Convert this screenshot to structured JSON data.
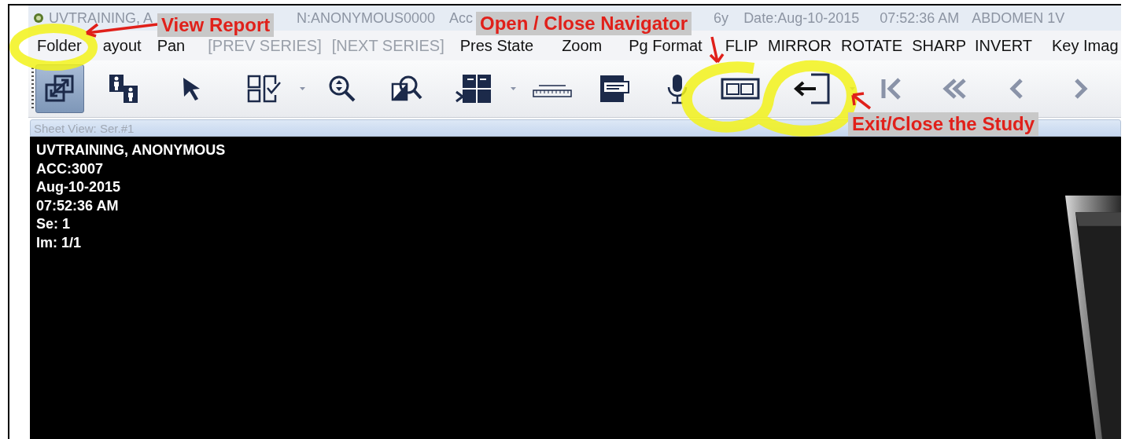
{
  "window": {
    "title_segments": [
      "UVTRAINING, A",
      "N:ANONYMOUS0000",
      "Acc",
      "6y",
      "Date:Aug-10-2015",
      "07:52:36 AM",
      "ABDOMEN 1V"
    ]
  },
  "menu": [
    {
      "label": "Folder",
      "disabled": false
    },
    {
      "label": "ayout",
      "disabled": false
    },
    {
      "label": "Pan",
      "disabled": false
    },
    {
      "label": "[PREV SERIES]",
      "disabled": true
    },
    {
      "label": "[NEXT SERIES]",
      "disabled": true
    },
    {
      "label": "Pres State",
      "disabled": false
    },
    {
      "label": "Zoom",
      "disabled": false
    },
    {
      "label": "Pg Format",
      "disabled": false
    },
    {
      "label": "FLIP",
      "disabled": false
    },
    {
      "label": "MIRROR",
      "disabled": false
    },
    {
      "label": "ROTATE",
      "disabled": false
    },
    {
      "label": "SHARP",
      "disabled": false
    },
    {
      "label": "INVERT",
      "disabled": false
    },
    {
      "label": "Key Imag",
      "disabled": false
    }
  ],
  "toolbar": [
    {
      "kind": "expand",
      "selected": true
    },
    {
      "kind": "figures",
      "selected": false
    },
    {
      "kind": "pointer",
      "selected": false
    },
    {
      "kind": "layout",
      "selected": false,
      "caret": true
    },
    {
      "kind": "zoom",
      "selected": false
    },
    {
      "kind": "magnify-area",
      "selected": false
    },
    {
      "kind": "split",
      "selected": false,
      "caret": true
    },
    {
      "kind": "ruler",
      "selected": false
    },
    {
      "kind": "report",
      "selected": false
    },
    {
      "kind": "mic",
      "selected": false
    },
    {
      "kind": "navigator",
      "selected": false
    },
    {
      "kind": "exit",
      "selected": false,
      "caret": true
    },
    {
      "kind": "first",
      "selected": false
    },
    {
      "kind": "double-left",
      "selected": false
    },
    {
      "kind": "left",
      "selected": false
    },
    {
      "kind": "right",
      "selected": false
    }
  ],
  "sheet_view": {
    "title": "Sheet View: Ser.#1"
  },
  "viewer": {
    "overlay_lines": [
      "UVTRAINING, ANONYMOUS",
      "ACC:3007",
      "Aug-10-2015",
      "07:52:36 AM",
      "Se: 1",
      "Im: 1/1"
    ],
    "image": {
      "kind": "picture"
    }
  },
  "annotations": [
    {
      "text": "View Report"
    },
    {
      "text": "Open / Close Navigator"
    },
    {
      "text": "Exit/Close the Study"
    }
  ]
}
